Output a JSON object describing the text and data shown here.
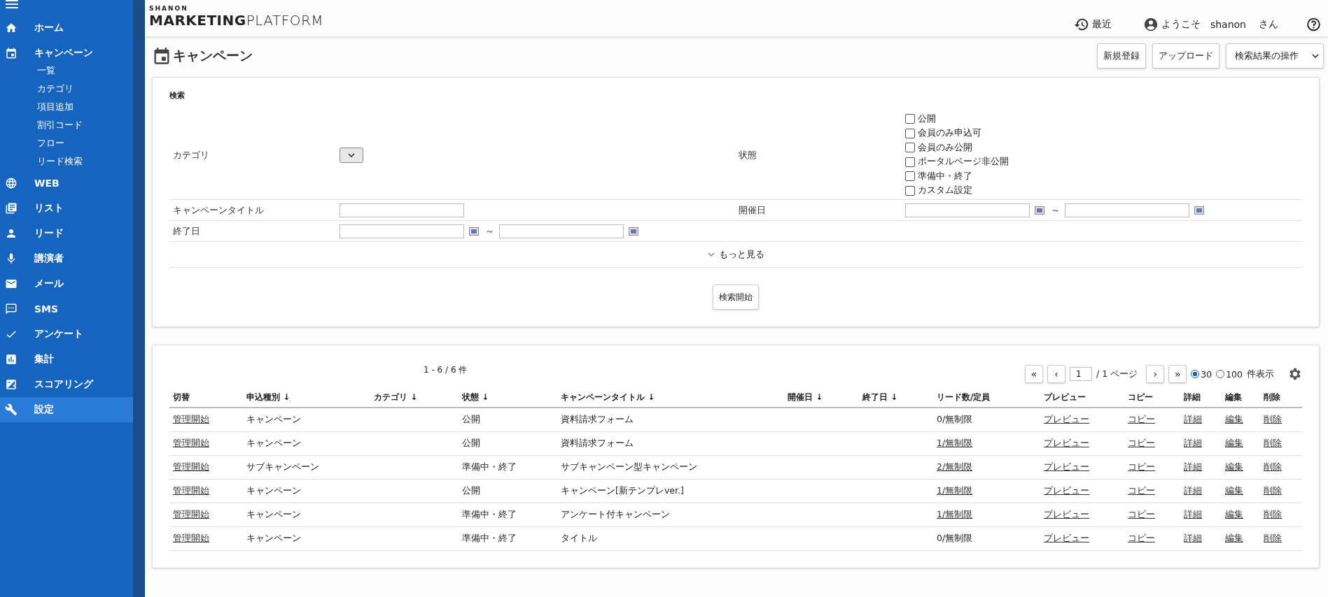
{
  "sidebar": {
    "items": [
      {
        "kind": "home",
        "label": "ホーム",
        "selected": false
      },
      {
        "kind": "calendar",
        "label": "キャンペーン",
        "selected": false,
        "children": [
          {
            "label": "一覧"
          },
          {
            "label": "カテゴリ"
          },
          {
            "label": "項目追加"
          },
          {
            "label": "割引コード"
          },
          {
            "label": "フロー"
          },
          {
            "label": "リード検索"
          }
        ]
      },
      {
        "kind": "globe",
        "label": "WEB",
        "selected": false
      },
      {
        "kind": "list",
        "label": "リスト",
        "selected": false
      },
      {
        "kind": "person",
        "label": "リード",
        "selected": false
      },
      {
        "kind": "mic",
        "label": "講演者",
        "selected": false
      },
      {
        "kind": "mail",
        "label": "メール",
        "selected": false
      },
      {
        "kind": "chat",
        "label": "SMS",
        "selected": false
      },
      {
        "kind": "check",
        "label": "アンケート",
        "selected": false
      },
      {
        "kind": "chart",
        "label": "集計",
        "selected": false
      },
      {
        "kind": "score",
        "label": "スコアリング",
        "selected": false
      },
      {
        "kind": "wrench",
        "label": "設定",
        "selected": true
      }
    ]
  },
  "header": {
    "logo": {
      "small": "SHANON",
      "bold": "MARKETING",
      "light": "PLATFORM"
    },
    "recent": "最近",
    "welcome": "ようこそ",
    "user": "shanon",
    "honorific": "さん"
  },
  "page": {
    "title": "キャンペーン",
    "buttons": [
      "新規登録",
      "アップロード"
    ],
    "dropdown": "検索結果の操作"
  },
  "search": {
    "heading": "検索",
    "category_label": "カテゴリ",
    "status_label": "状態",
    "statuses": [
      {
        "label": "公開",
        "checked": false
      },
      {
        "label": "会員のみ申込可",
        "checked": false
      },
      {
        "label": "会員のみ公開",
        "checked": false
      },
      {
        "label": "ポータルページ非公開",
        "checked": false
      },
      {
        "label": "準備中・終了",
        "checked": false
      },
      {
        "label": "カスタム設定",
        "checked": false
      }
    ],
    "title_label": "キャンペーンタイトル",
    "start_label": "開催日",
    "end_label": "終了日",
    "range_sep": "～",
    "more": "もっと見る",
    "submit": "検索開始"
  },
  "results": {
    "count": "1 - 6 / 6 件",
    "page": "1",
    "pages": "/ 1 ページ",
    "first": "«",
    "prev": "‹",
    "next": "›",
    "last": "»",
    "per_page": [
      {
        "label": "30",
        "selected": true
      },
      {
        "label": "100",
        "selected": false
      }
    ],
    "per_page_suffix": "件表示",
    "columns": [
      "切替",
      "申込種別 ↓",
      "カテゴリ ↓",
      "状態 ↓",
      "キャンペーンタイトル ↓",
      "開催日 ↓",
      "終了日 ↓",
      "リード数/定員",
      "プレビュー",
      "コピー",
      "詳細",
      "編集",
      "削除"
    ],
    "rows": [
      {
        "toggle": "管理開始",
        "type": "キャンペーン",
        "status": "公開",
        "title": "資料請求フォーム",
        "leads": "0/無制限",
        "leads_link": false,
        "preview": "プレビュー",
        "copy": "コピー",
        "detail": "詳細",
        "edit": "編集",
        "delete": "削除"
      },
      {
        "toggle": "管理開始",
        "type": "キャンペーン",
        "status": "公開",
        "title": "資料請求フォーム",
        "leads": "1/無制限",
        "leads_link": true,
        "preview": "プレビュー",
        "copy": "コピー",
        "detail": "詳細",
        "edit": "編集",
        "delete": "削除"
      },
      {
        "toggle": "管理開始",
        "type": "サブキャンペーン",
        "status": "準備中・終了",
        "title": "サブキャンペーン型キャンペーン",
        "leads": "2/無制限",
        "leads_link": true,
        "preview": "プレビュー",
        "copy": "コピー",
        "detail": "詳細",
        "edit": "編集",
        "delete": "削除"
      },
      {
        "toggle": "管理開始",
        "type": "キャンペーン",
        "status": "公開",
        "title": "キャンペーン[新テンプレver.]",
        "leads": "1/無制限",
        "leads_link": true,
        "preview": "プレビュー",
        "copy": "コピー",
        "detail": "詳細",
        "edit": "編集",
        "delete": "削除"
      },
      {
        "toggle": "管理開始",
        "type": "キャンペーン",
        "status": "準備中・終了",
        "title": "アンケート付キャンペーン",
        "leads": "1/無制限",
        "leads_link": true,
        "preview": "プレビュー",
        "copy": "コピー",
        "detail": "詳細",
        "edit": "編集",
        "delete": "削除"
      },
      {
        "toggle": "管理開始",
        "type": "キャンペーン",
        "status": "準備中・終了",
        "title": "タイトル",
        "leads": "0/無制限",
        "leads_link": false,
        "preview": "プレビュー",
        "copy": "コピー",
        "detail": "詳細",
        "edit": "編集",
        "delete": "削除"
      }
    ]
  }
}
